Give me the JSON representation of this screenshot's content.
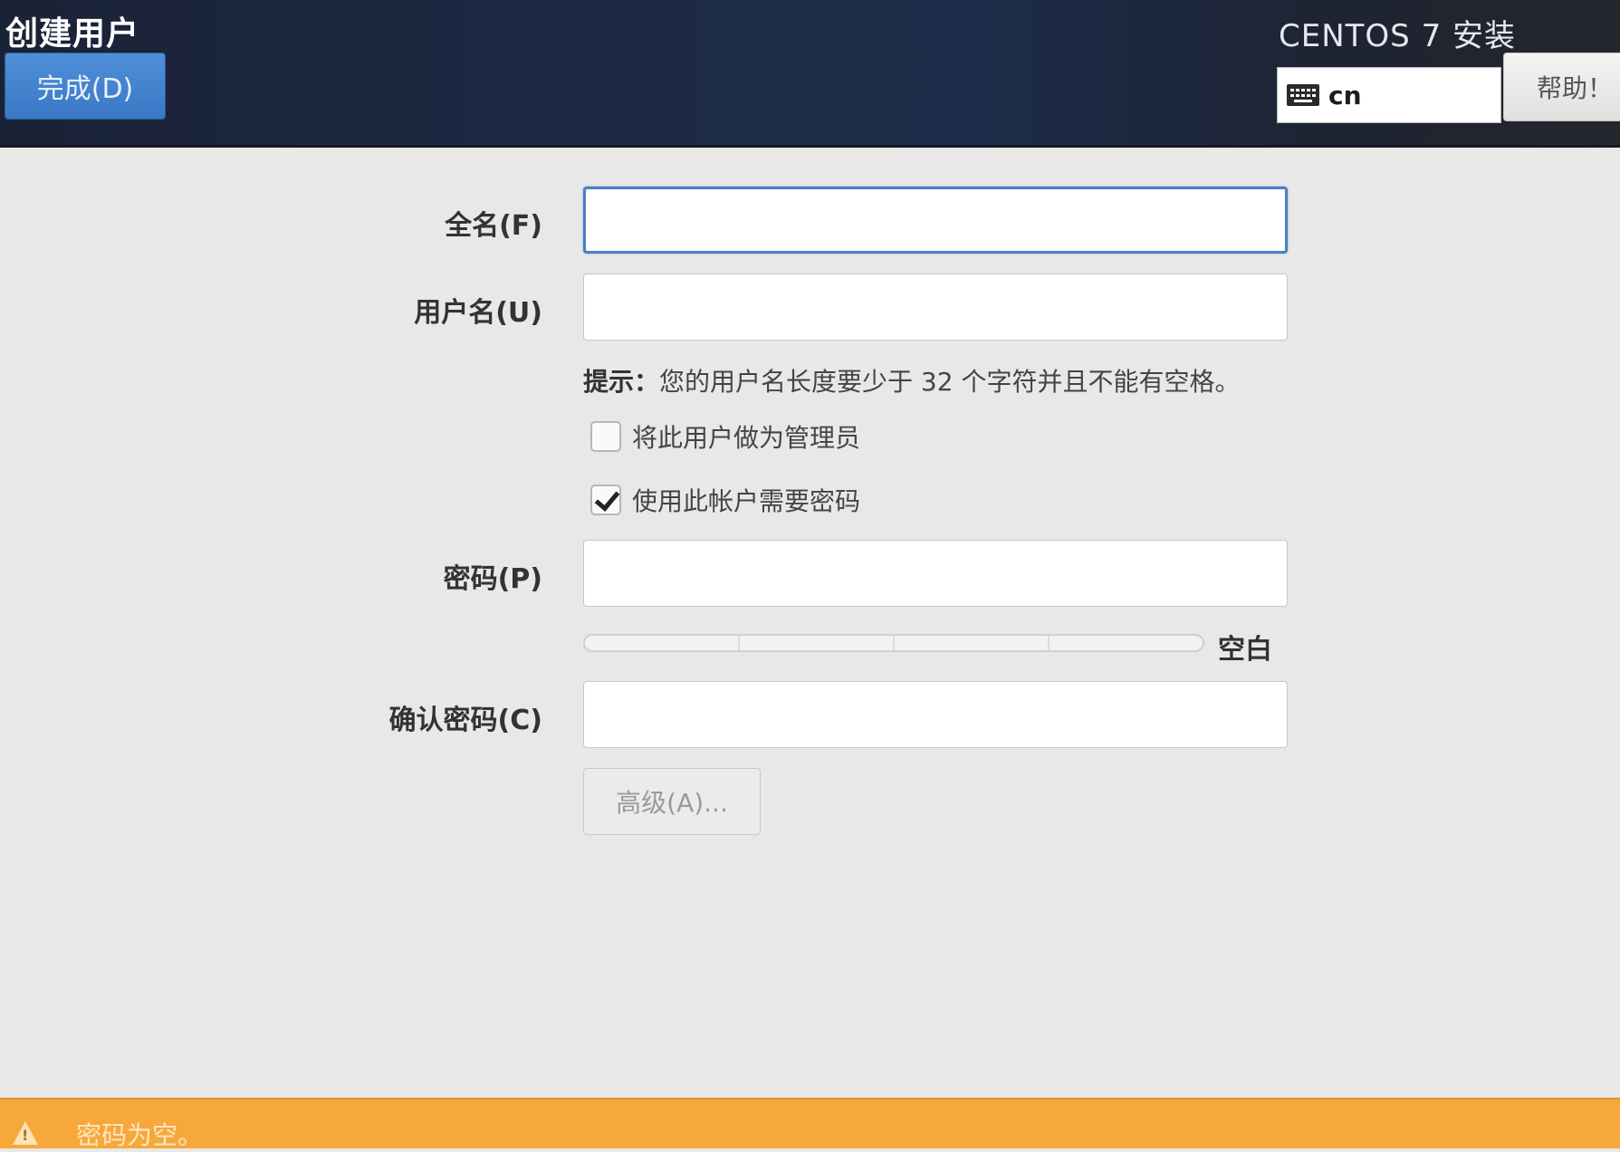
{
  "header": {
    "page_title": "创建用户",
    "done_label": "完成(D)",
    "product_title": "CENTOS 7 安装",
    "keyboard_layout": "cn",
    "help_label": "帮助！"
  },
  "form": {
    "fullname_label": "全名(F)",
    "fullname_value": "",
    "username_label": "用户名(U)",
    "username_value": "",
    "hint_prefix": "提示：",
    "hint_text": "您的用户名长度要少于 32 个字符并且不能有空格。",
    "admin_checkbox_label": "将此用户做为管理员",
    "admin_checked": false,
    "require_password_label": "使用此帐户需要密码",
    "require_password_checked": true,
    "password_label": "密码(P)",
    "password_value": "",
    "strength_label": "空白",
    "strength_level": 0,
    "confirm_label": "确认密码(C)",
    "confirm_value": "",
    "advanced_label": "高级(A)..."
  },
  "warning": {
    "icon": "warning-icon",
    "text": "密码为空。"
  },
  "colors": {
    "primary_button": "#3a78c6",
    "focus_border": "#4a7fc8",
    "warning_bar": "#f6a83a"
  }
}
